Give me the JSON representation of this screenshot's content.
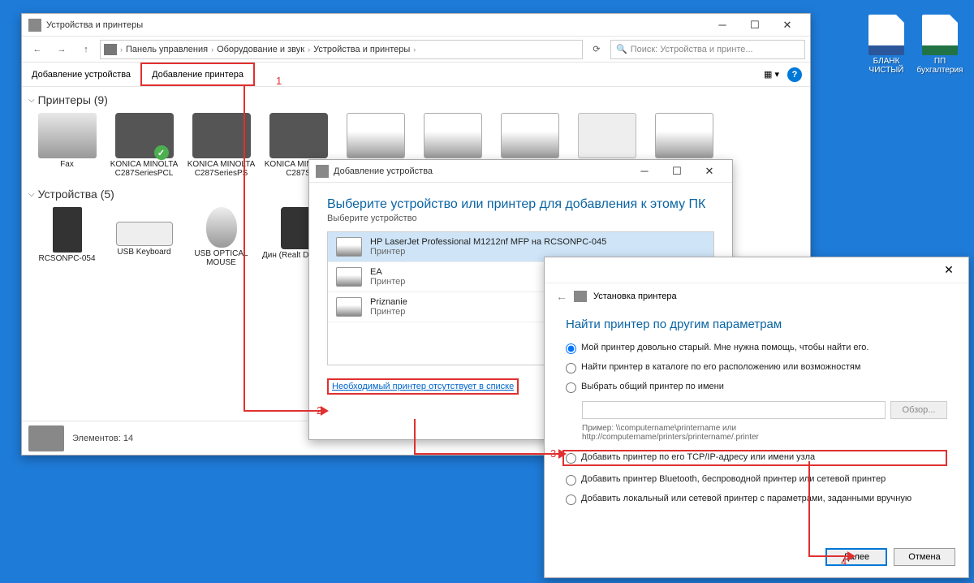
{
  "desktop": {
    "icons": [
      {
        "name": "word-doc",
        "label": "БЛАНК ЧИСТЫЙ"
      },
      {
        "name": "excel-doc",
        "label": "ПП бухгалтерия"
      }
    ]
  },
  "mainWindow": {
    "title": "Устройства и принтеры",
    "breadcrumb": [
      "Панель управления",
      "Оборудование и звук",
      "Устройства и принтеры"
    ],
    "searchPlaceholder": "Поиск: Устройства и принте...",
    "toolbar": {
      "addDevice": "Добавление устройства",
      "addPrinter": "Добавление принтера"
    },
    "sections": {
      "printers": "Принтеры (9)",
      "devices": "Устройства (5)"
    },
    "printers": [
      {
        "name": "Fax"
      },
      {
        "name": "KONICA MINOLTA C287SeriesPCL",
        "default": true
      },
      {
        "name": "KONICA MINOLTA C287SeriesPS"
      },
      {
        "name": "KONICA MINOLTA C287S"
      },
      {
        "name": ""
      },
      {
        "name": ""
      },
      {
        "name": ""
      },
      {
        "name": ""
      },
      {
        "name": ""
      }
    ],
    "devices": [
      {
        "name": "RCSONPC-054"
      },
      {
        "name": "USB Keyboard"
      },
      {
        "name": "USB OPTICAL MOUSE"
      },
      {
        "name": "Дин (Realt Definiti..."
      },
      {
        "name": ""
      }
    ],
    "status": "Элементов: 14"
  },
  "addDialog": {
    "title": "Добавление устройства",
    "heading": "Выберите устройство или принтер для добавления к этому ПК",
    "sub": "Выберите устройство",
    "list": [
      {
        "name": "HP LaserJet Professional M1212nf MFP на RCSONPC-045",
        "type": "Принтер"
      },
      {
        "name": "EA",
        "type": "Принтер"
      },
      {
        "name": "Priznanie",
        "type": "Принтер"
      }
    ],
    "missingLink": "Необходимый принтер отсутствует в списке"
  },
  "installDialog": {
    "header": "Установка принтера",
    "heading": "Найти принтер по другим параметрам",
    "options": {
      "old": "Мой принтер довольно старый. Мне нужна помощь, чтобы найти его.",
      "catalog": "Найти принтер в каталоге по его расположению или возможностям",
      "shared": "Выбрать общий принтер по имени",
      "browse": "Обзор...",
      "example1": "Пример: \\\\computername\\printername или",
      "example2": "http://computername/printers/printername/.printer",
      "tcpip": "Добавить принтер по его TCP/IP-адресу или имени узла",
      "bluetooth": "Добавить принтер Bluetooth, беспроводной принтер или сетевой принтер",
      "local": "Добавить локальный или сетевой принтер с параметрами, заданными вручную"
    },
    "buttons": {
      "next": "Далее",
      "cancel": "Отмена"
    }
  },
  "annotations": {
    "n1": "1",
    "n2": "2",
    "n3": "3",
    "n4": "4"
  }
}
